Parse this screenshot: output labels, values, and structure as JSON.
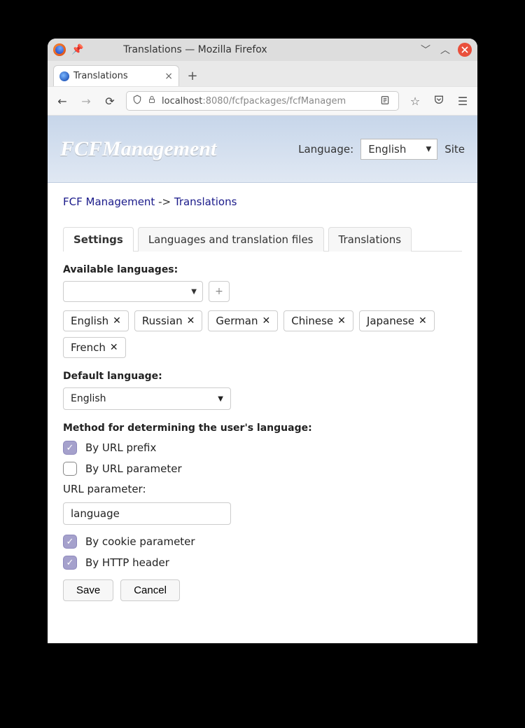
{
  "window": {
    "title": "Translations — Mozilla Firefox"
  },
  "browser_tab": {
    "label": "Translations"
  },
  "url": {
    "host": "localhost",
    "port_path": ":8080/fcfpackages/fcfManagem"
  },
  "header": {
    "brand": "FCFManagement",
    "language_label": "Language:",
    "language_value": "English",
    "site_link": "Site"
  },
  "breadcrumb": {
    "root": "FCF Management",
    "sep": "->",
    "leaf": "Translations"
  },
  "tabs": {
    "settings": "Settings",
    "langs": "Languages and translation files",
    "trans": "Translations"
  },
  "available": {
    "label": "Available languages:",
    "tags": [
      "English",
      "Russian",
      "German",
      "Chinese",
      "Japanese",
      "French"
    ]
  },
  "default_lang": {
    "label": "Default language:",
    "value": "English"
  },
  "method": {
    "label": "Method for determining the user's language:",
    "by_url_prefix": "By URL prefix",
    "by_url_param": "By URL parameter",
    "url_param_label": "URL parameter:",
    "url_param_value": "language",
    "by_cookie": "By cookie parameter",
    "by_http": "By HTTP header"
  },
  "buttons": {
    "save": "Save",
    "cancel": "Cancel"
  }
}
